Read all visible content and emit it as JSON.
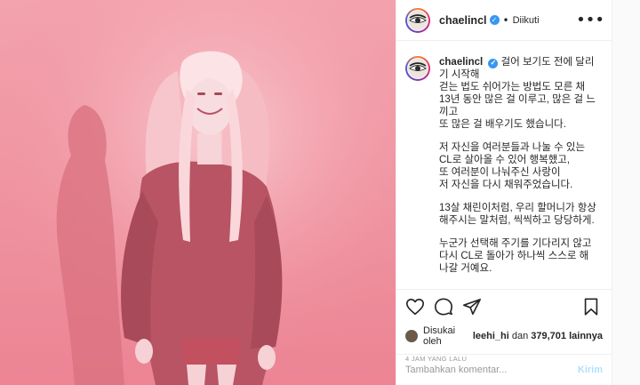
{
  "post": {
    "username": "chaelincl",
    "follow_status": "Diikuti",
    "more_label": "•••"
  },
  "caption": {
    "username": "chaelincl",
    "paragraphs": [
      "걸어 보기도 전에 달리기 시작해\n걷는 법도 쉬어가는 방법도 모른 채 13년 동안 많은 걸 이루고, 많은 걸 느끼고\n또 많은 걸 배우기도 했습니다.",
      "저 자신을 여러분들과 나눌 수 있는 CL로 살아올 수 있어 행복했고,\n또 여러분이 나눠주신 사랑이\n저 자신을 다시 채워주었습니다.",
      "13살 채린이처럼, 우리 할머니가 항상 해주시는 말처럼, 씩씩하고 당당하게.",
      "누군가 선택해 주기를 기다리지 않고 다시 CL로 돌아가 하나씩 스스로 해나갈 거예요."
    ]
  },
  "likes": {
    "prefix": "Disukai oleh",
    "user": "leehi_hi",
    "and": "dan",
    "count": "379,701",
    "suffix": "lainnya"
  },
  "timestamp": "4 JAM YANG LALU",
  "comment": {
    "placeholder": "Tambahkan komentar...",
    "send_label": "Kirim"
  },
  "colors": {
    "photo_tint": "#f08f9d",
    "verified": "#3897f0",
    "send_disabled": "#b2dffc"
  },
  "icons": [
    "heart-icon",
    "comment-icon",
    "share-icon",
    "bookmark-icon",
    "more-icon",
    "verified-icon"
  ]
}
